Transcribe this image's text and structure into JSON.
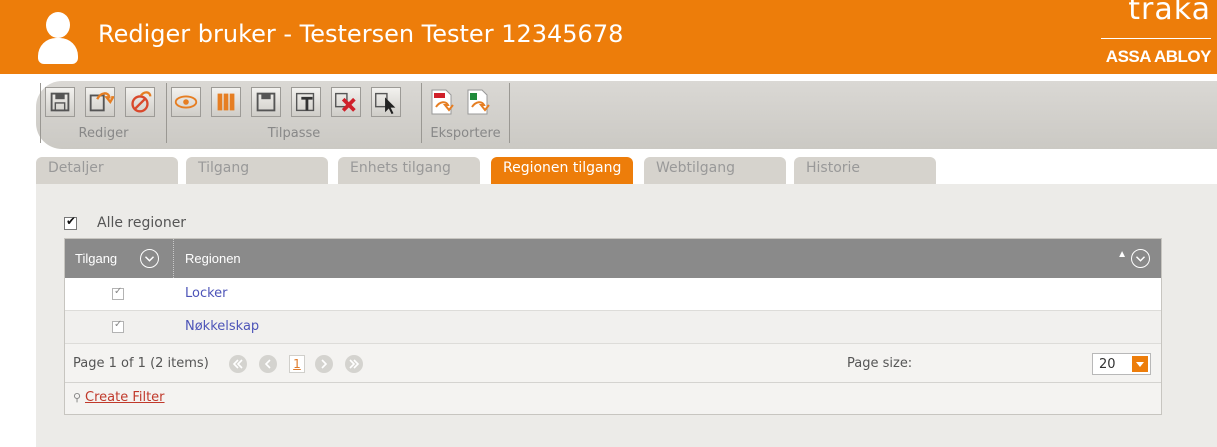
{
  "header": {
    "title": "Rediger bruker - Testersen Tester 12345678",
    "brand_name": "traka",
    "brand_sub": "ASSA ABLOY",
    "accent_color": "#ed7d0a"
  },
  "toolbar": {
    "groups": [
      {
        "label": "Rediger",
        "buttons": [
          "save-icon",
          "save-and-close-icon",
          "cancel-icon"
        ]
      },
      {
        "label": "Tilpasse",
        "buttons": [
          "view-icon",
          "columns-icon",
          "save-layout-icon",
          "text-format-icon",
          "delete-icon",
          "select-cursor-icon"
        ]
      },
      {
        "label": "Eksportere",
        "buttons": [
          "export-pdf-icon",
          "export-excel-icon"
        ]
      }
    ]
  },
  "tabs": [
    {
      "label": "Detaljer",
      "active": false
    },
    {
      "label": "Tilgang",
      "active": false
    },
    {
      "label": "Enhets tilgang",
      "active": false
    },
    {
      "label": "Regionen tilgang",
      "active": true
    },
    {
      "label": "Webtilgang",
      "active": false
    },
    {
      "label": "Historie",
      "active": false
    }
  ],
  "content": {
    "all_regions_label": "Alle regioner",
    "all_regions_checked": true,
    "grid": {
      "columns": [
        "Tilgang",
        "Regionen"
      ],
      "rows": [
        {
          "access": true,
          "region": "Locker"
        },
        {
          "access": true,
          "region": "Nøkkelskap"
        }
      ]
    },
    "pager": {
      "summary": "Page 1 of 1 (2 items)",
      "current_page": "1",
      "page_size_label": "Page size:",
      "page_size": "20"
    },
    "filter": {
      "link": "Create Filter"
    }
  }
}
